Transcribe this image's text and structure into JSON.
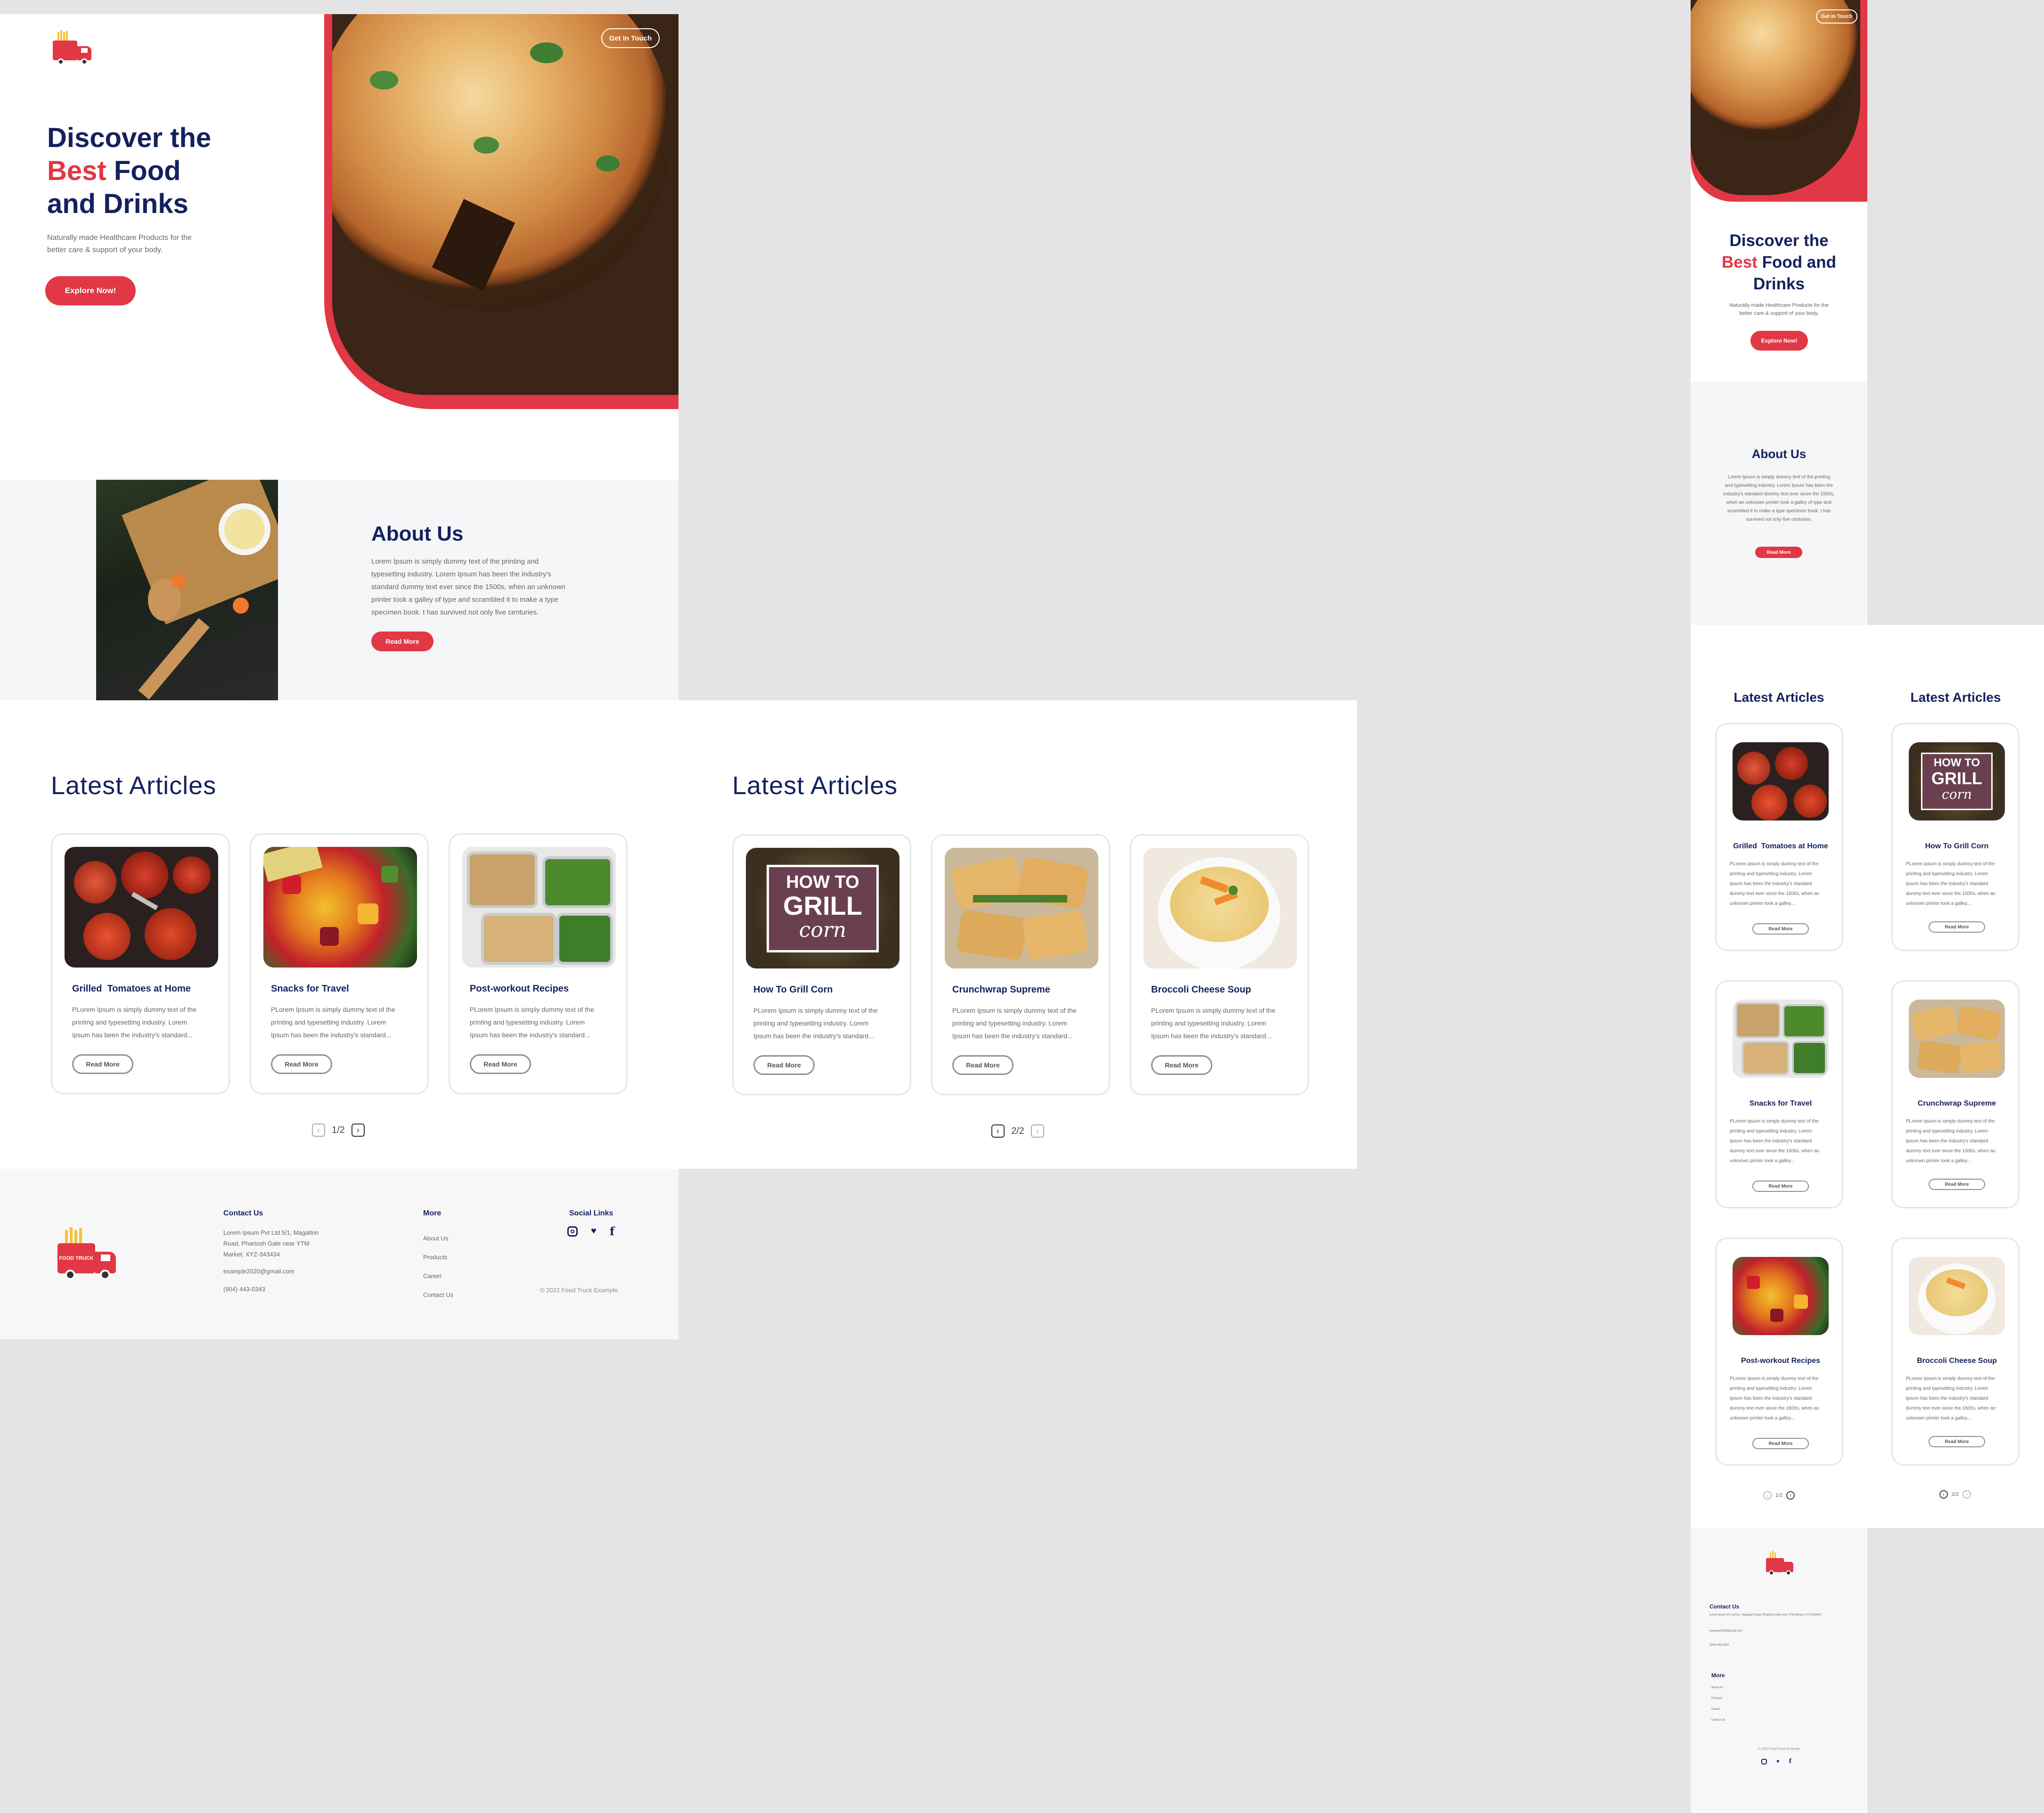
{
  "brand": {
    "logo_alt": "food-truck-logo",
    "logo_text": "FOOD TRUCK",
    "colors": {
      "accent": "#e23744",
      "navy": "#15215e",
      "muted": "#666666",
      "section_bg": "#f5f6f8",
      "canvas_bg": "#e4e4e4"
    }
  },
  "hero": {
    "get_in_touch": "Get In Touch",
    "title_line1": "Discover the",
    "title_best": "Best",
    "title_food": "Food",
    "title_line3": "and Drinks",
    "subtitle_line1": "Naturally made Healthcare Products for the",
    "subtitle_line2": "better care & support of your body.",
    "cta": "Explore Now!"
  },
  "about": {
    "title": "About Us",
    "body_lines": [
      "Lorem Ipsum is simply dummy text of the printing and",
      "typesetting industry. Lorem Ipsum has been the industry's",
      "standard dummy text ever since the 1500s, when an unknown",
      "printer took a galley of type and scrambled it to make a type",
      "specimen book. t has survived not only five centuries."
    ],
    "cta": "Read More"
  },
  "articles": {
    "title": "Latest Articles",
    "read_more": "Read More",
    "excerpt_lines": [
      "PLorem Ipsum is simply dummy text of the",
      "printing and typesetting industry. Lorem",
      "Ipsum has been the industry's standard..."
    ],
    "page1": {
      "indicator": "1/2",
      "items": [
        {
          "title": "Grilled  Tomatoes at Home",
          "image": "grilled-tomatoes"
        },
        {
          "title": "Snacks for Travel",
          "image": "snacks"
        },
        {
          "title": "Post-workout Recipes",
          "image": "meal-prep"
        }
      ]
    },
    "page2": {
      "indicator": "2/2",
      "items": [
        {
          "title": "How To Grill Corn",
          "image": "grill-corn"
        },
        {
          "title": "Crunchwrap Supreme",
          "image": "crunchwrap"
        },
        {
          "title": "Broccoli Cheese Soup",
          "image": "soup"
        }
      ]
    },
    "grill_corn_art": {
      "line1": "HOW TO",
      "line2": "GRILL",
      "line3": "corn"
    }
  },
  "footer": {
    "contact_title": "Contact Us",
    "address_lines": [
      "Lorem Ipsum Pvt Ltd 5/1, Magalton",
      "Road, Phartosh Gate near YTM",
      "Market, XYZ-343434"
    ],
    "email": "example2020@gmail.com",
    "phone": "(904) 443-0343",
    "more_title": "More",
    "links": [
      "About Us",
      "Products",
      "Career",
      "Contact Us"
    ],
    "social_title": "Social Links",
    "social_icons": [
      "instagram-icon",
      "twitter-icon",
      "facebook-icon"
    ],
    "copyright": "© 2022 Food Truck Example"
  },
  "mobile": {
    "get_in_touch": "Get In Touch",
    "title_line1": "Discover the",
    "title_best": "Best",
    "title_rest": "Food and",
    "title_line3": "Drinks",
    "subtitle_line1": "Naturally made Healthcare Products for the",
    "subtitle_line2": "better care & support of your body.",
    "cta": "Explore Now!",
    "about_title": "About Us",
    "about_lines": [
      "Lorem Ipsum is simply dummy text of the printing",
      "and typesetting industry. Lorem Ipsum has been the",
      "industry's standard dummy text ever since the 1500s,",
      "when an unknown printer took a galley of type and",
      "scrambled it to make a type specimen book. t has",
      "survived not only five centuries."
    ],
    "about_cta": "Read More",
    "articles_title": "Latest Articles",
    "excerpt_lines": [
      "PLorem Ipsum is simply dummy text of the",
      "printing and typesetting industry. Lorem",
      "Ipsum has been the industry's standard",
      "dummy text ever since the 1500s, when an",
      "unknown printer took a galley..."
    ],
    "col1": [
      {
        "title": "Grilled  Tomatoes at Home"
      },
      {
        "title": "Snacks for Travel"
      },
      {
        "title": "Post-workout Recipes"
      }
    ],
    "col2": [
      {
        "title": "How To Grill Corn"
      },
      {
        "title": "Crunchwrap Supreme"
      },
      {
        "title": "Broccoli Cheese Soup"
      }
    ],
    "indicator1": "1/2",
    "indicator2": "2/2",
    "footer_contact_title": "Contact Us",
    "footer_address": "Lorem Ipsum Pvt Ltd 5/1, Magalton Road, Phartosh Gate near YTM Market, XYZ-343434",
    "footer_email": "example2020@gmail.com",
    "footer_phone": "(904) 443-0343",
    "footer_more_title": "More",
    "footer_links": [
      "About Us",
      "Products",
      "Career",
      "Contact Us"
    ],
    "footer_copyright": "© 2022 Food Truck Example"
  }
}
